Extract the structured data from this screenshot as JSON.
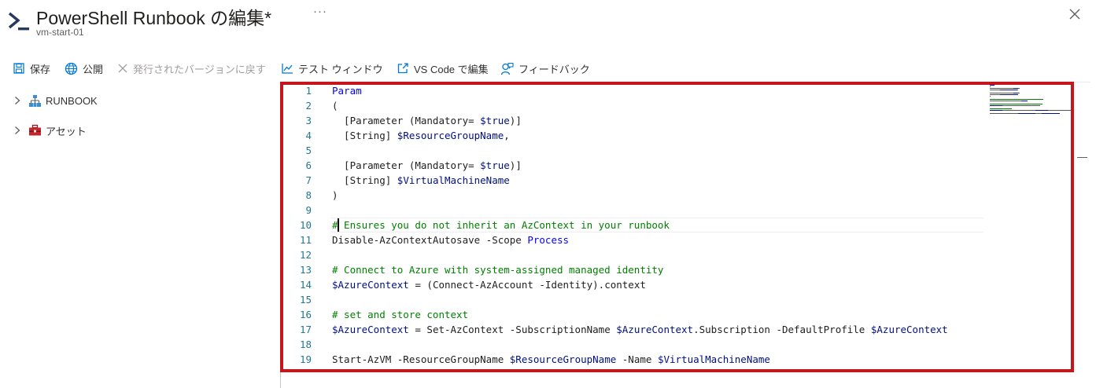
{
  "header": {
    "title": "PowerShell Runbook の編集*",
    "subtitle": "vm-start-01",
    "more": "···"
  },
  "toolbar": {
    "save": "保存",
    "publish": "公開",
    "revert": "発行されたバージョンに戻す",
    "test": "テスト ウィンドウ",
    "vscode": "VS Code で編集",
    "feedback": "フィードバック"
  },
  "tree": {
    "runbook": "RUNBOOK",
    "assets": "アセット"
  },
  "editor": {
    "lines": [
      {
        "n": "1",
        "t": [
          [
            "kw",
            "Param"
          ]
        ]
      },
      {
        "n": "2",
        "t": [
          [
            "",
            "("
          ]
        ]
      },
      {
        "n": "3",
        "t": [
          [
            "",
            "  [Parameter (Mandatory= "
          ],
          [
            "var",
            "$true"
          ],
          [
            "",
            ")]"
          ]
        ]
      },
      {
        "n": "4",
        "t": [
          [
            "",
            "  [String] "
          ],
          [
            "var",
            "$ResourceGroupName"
          ],
          [
            "",
            ","
          ]
        ]
      },
      {
        "n": "5",
        "t": []
      },
      {
        "n": "6",
        "t": [
          [
            "",
            "  [Parameter (Mandatory= "
          ],
          [
            "var",
            "$true"
          ],
          [
            "",
            ")]"
          ]
        ]
      },
      {
        "n": "7",
        "t": [
          [
            "",
            "  [String] "
          ],
          [
            "var",
            "$VirtualMachineName"
          ]
        ]
      },
      {
        "n": "8",
        "t": [
          [
            "",
            ")"
          ]
        ]
      },
      {
        "n": "9",
        "t": []
      },
      {
        "n": "10",
        "t": [
          [
            "cmt",
            "# Ensures you do not inherit an AzContext in your runbook"
          ]
        ]
      },
      {
        "n": "11",
        "t": [
          [
            "",
            "Disable-AzContextAutosave -Scope "
          ],
          [
            "kw",
            "Process"
          ]
        ]
      },
      {
        "n": "12",
        "t": []
      },
      {
        "n": "13",
        "t": [
          [
            "cmt",
            "# Connect to Azure with system-assigned managed identity"
          ]
        ]
      },
      {
        "n": "14",
        "t": [
          [
            "var",
            "$AzureContext"
          ],
          [
            "",
            " = (Connect-AzAccount -Identity).context"
          ]
        ]
      },
      {
        "n": "15",
        "t": []
      },
      {
        "n": "16",
        "t": [
          [
            "cmt",
            "# set and store context"
          ]
        ]
      },
      {
        "n": "17",
        "t": [
          [
            "var",
            "$AzureContext"
          ],
          [
            "",
            " = Set-AzContext -SubscriptionName "
          ],
          [
            "var",
            "$AzureContext"
          ],
          [
            "",
            ".Subscription -DefaultProfile "
          ],
          [
            "var",
            "$AzureContext"
          ]
        ]
      },
      {
        "n": "18",
        "t": []
      },
      {
        "n": "19",
        "t": [
          [
            "",
            "Start-AzVM -ResourceGroupName "
          ],
          [
            "var",
            "$ResourceGroupName"
          ],
          [
            "",
            " -Name "
          ],
          [
            "var",
            "$VirtualMachineName"
          ]
        ]
      }
    ]
  },
  "colors": {
    "accent": "#0078d4",
    "highlight": "#c4161c",
    "keyword": "#0000ff",
    "variable": "#001080",
    "comment": "#008000",
    "line_number": "#237893"
  }
}
